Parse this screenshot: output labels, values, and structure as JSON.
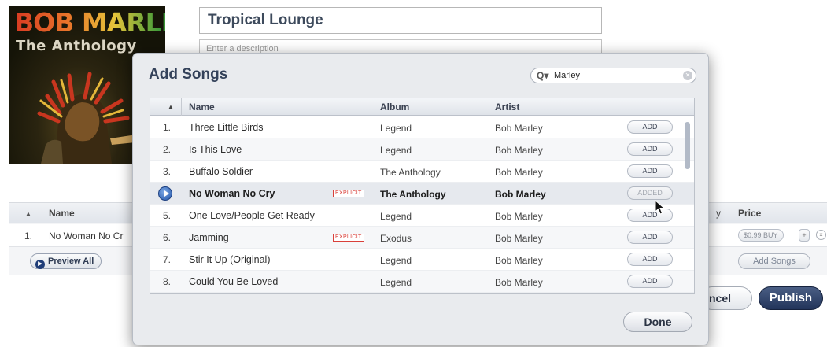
{
  "album": {
    "title_line1": "BOB MARLEY",
    "title_line2": "The Anthology"
  },
  "playlist": {
    "title": "Tropical Lounge",
    "description_placeholder": "Enter a description"
  },
  "background_table": {
    "header_name": "Name",
    "header_partial": "y",
    "header_price": "Price",
    "row": {
      "index": "1.",
      "name": "No Woman No Cr",
      "price": "$0.99 BUY"
    },
    "plus_label": "+",
    "remove_label": "×"
  },
  "actions": {
    "preview_all": "Preview All",
    "add_songs": "Add Songs",
    "cancel": "ncel",
    "publish": "Publish"
  },
  "dialog": {
    "title": "Add Songs",
    "search_value": "Marley",
    "columns": {
      "name": "Name",
      "album": "Album",
      "artist": "Artist"
    },
    "explicit_label": "EXPLICIT",
    "done": "Done",
    "songs": [
      {
        "index": "1.",
        "name": "Three Little Birds",
        "album": "Legend",
        "artist": "Bob Marley",
        "explicit": false,
        "action": "ADD",
        "playing": false
      },
      {
        "index": "2.",
        "name": "Is This Love",
        "album": "Legend",
        "artist": "Bob Marley",
        "explicit": false,
        "action": "ADD",
        "playing": false
      },
      {
        "index": "3.",
        "name": "Buffalo Soldier",
        "album": "The Anthology",
        "artist": "Bob Marley",
        "explicit": false,
        "action": "ADD",
        "playing": false
      },
      {
        "index": "4.",
        "name": "No Woman No Cry",
        "album": "The Anthology",
        "artist": "Bob Marley",
        "explicit": true,
        "action": "ADDED",
        "playing": true
      },
      {
        "index": "5.",
        "name": "One Love/People Get Ready",
        "album": "Legend",
        "artist": "Bob Marley",
        "explicit": false,
        "action": "ADD",
        "playing": false
      },
      {
        "index": "6.",
        "name": "Jamming",
        "album": "Exodus",
        "artist": "Bob Marley",
        "explicit": true,
        "action": "ADD",
        "playing": false
      },
      {
        "index": "7.",
        "name": "Stir It Up (Original)",
        "album": "Legend",
        "artist": "Bob Marley",
        "explicit": false,
        "action": "ADD",
        "playing": false
      },
      {
        "index": "8.",
        "name": "Could You Be Loved",
        "album": "Legend",
        "artist": "Bob Marley",
        "explicit": false,
        "action": "ADD",
        "playing": false
      }
    ]
  }
}
